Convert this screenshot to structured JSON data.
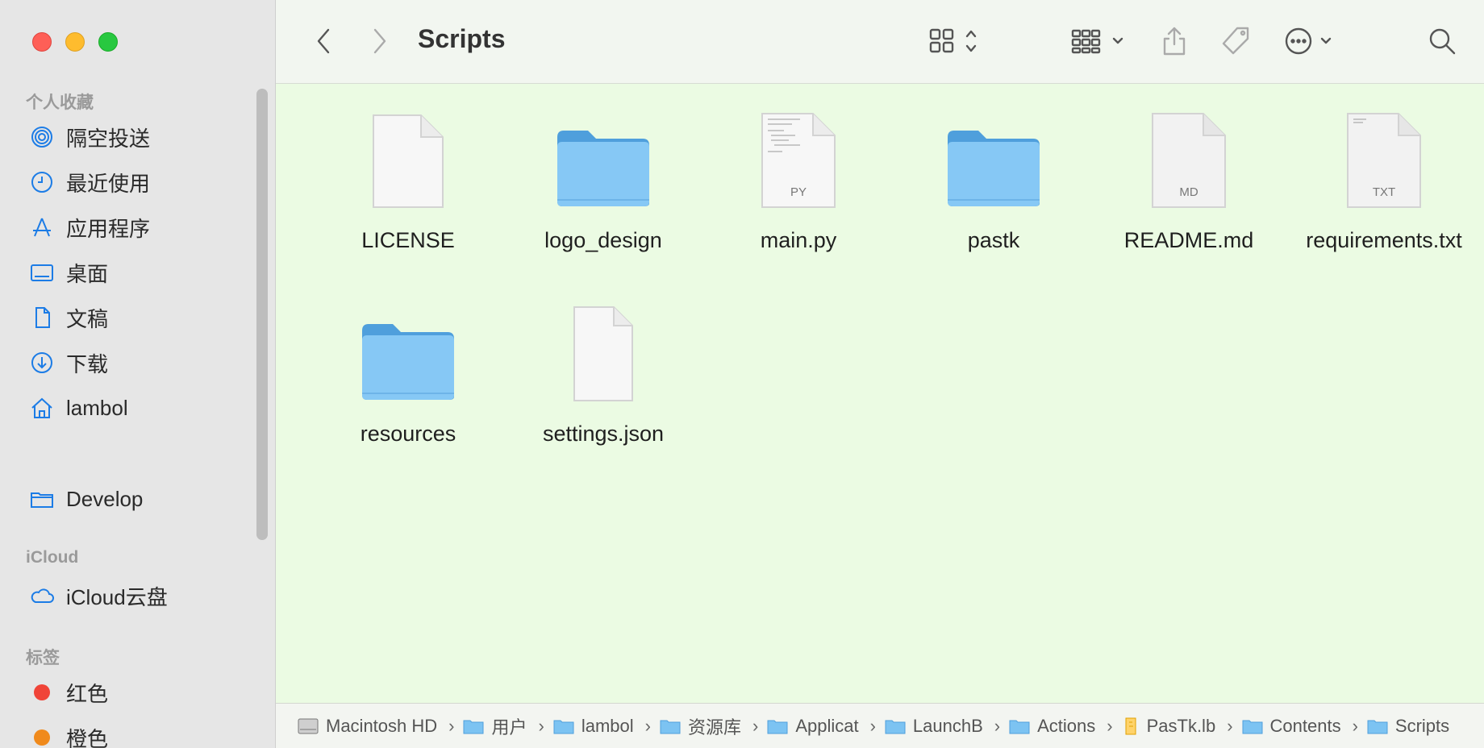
{
  "window": {
    "title": "Scripts"
  },
  "sidebar": {
    "favorites_title": "个人收藏",
    "favorites": [
      {
        "label": "隔空投送",
        "icon": "airdrop-icon"
      },
      {
        "label": "最近使用",
        "icon": "clock-icon"
      },
      {
        "label": "应用程序",
        "icon": "applications-icon"
      },
      {
        "label": "桌面",
        "icon": "desktop-icon"
      },
      {
        "label": "文稿",
        "icon": "document-icon"
      },
      {
        "label": "下载",
        "icon": "download-icon"
      },
      {
        "label": "lambol",
        "icon": "home-icon"
      },
      {
        "label": "Develop",
        "icon": "folder-icon"
      }
    ],
    "icloud_title": "iCloud",
    "icloud_items": [
      {
        "label": "iCloud云盘",
        "icon": "cloud-icon"
      }
    ],
    "tags_title": "标签",
    "tags": [
      {
        "label": "红色",
        "color": "#f04438"
      },
      {
        "label": "橙色",
        "color": "#f08a1c"
      }
    ]
  },
  "files": [
    {
      "name": "LICENSE",
      "kind": "doc",
      "ext": ""
    },
    {
      "name": "logo_design",
      "kind": "folder",
      "ext": ""
    },
    {
      "name": "main.py",
      "kind": "doc",
      "ext": "PY"
    },
    {
      "name": "pastk",
      "kind": "folder",
      "ext": ""
    },
    {
      "name": "README.md",
      "kind": "doc",
      "ext": "MD"
    },
    {
      "name": "requirements.txt",
      "kind": "doc",
      "ext": "TXT"
    },
    {
      "name": "resources",
      "kind": "folder",
      "ext": ""
    },
    {
      "name": "settings.json",
      "kind": "doc",
      "ext": ""
    }
  ],
  "pathbar": [
    {
      "label": "Macintosh HD",
      "icon": "disk-icon"
    },
    {
      "label": "用户",
      "icon": "folder-icon"
    },
    {
      "label": "lambol",
      "icon": "home-folder-icon"
    },
    {
      "label": "资源库",
      "icon": "folder-icon"
    },
    {
      "label": "Applicat",
      "icon": "folder-icon"
    },
    {
      "label": "LaunchB",
      "icon": "folder-icon"
    },
    {
      "label": "Actions",
      "icon": "folder-icon"
    },
    {
      "label": "PasTk.lb",
      "icon": "bundle-icon"
    },
    {
      "label": "Contents",
      "icon": "folder-icon"
    },
    {
      "label": "Scripts",
      "icon": "folder-icon"
    }
  ],
  "colors": {
    "accent": "#1c7ce6",
    "folder": "#7cc3f2",
    "content_bg": "#ebfbe3"
  }
}
